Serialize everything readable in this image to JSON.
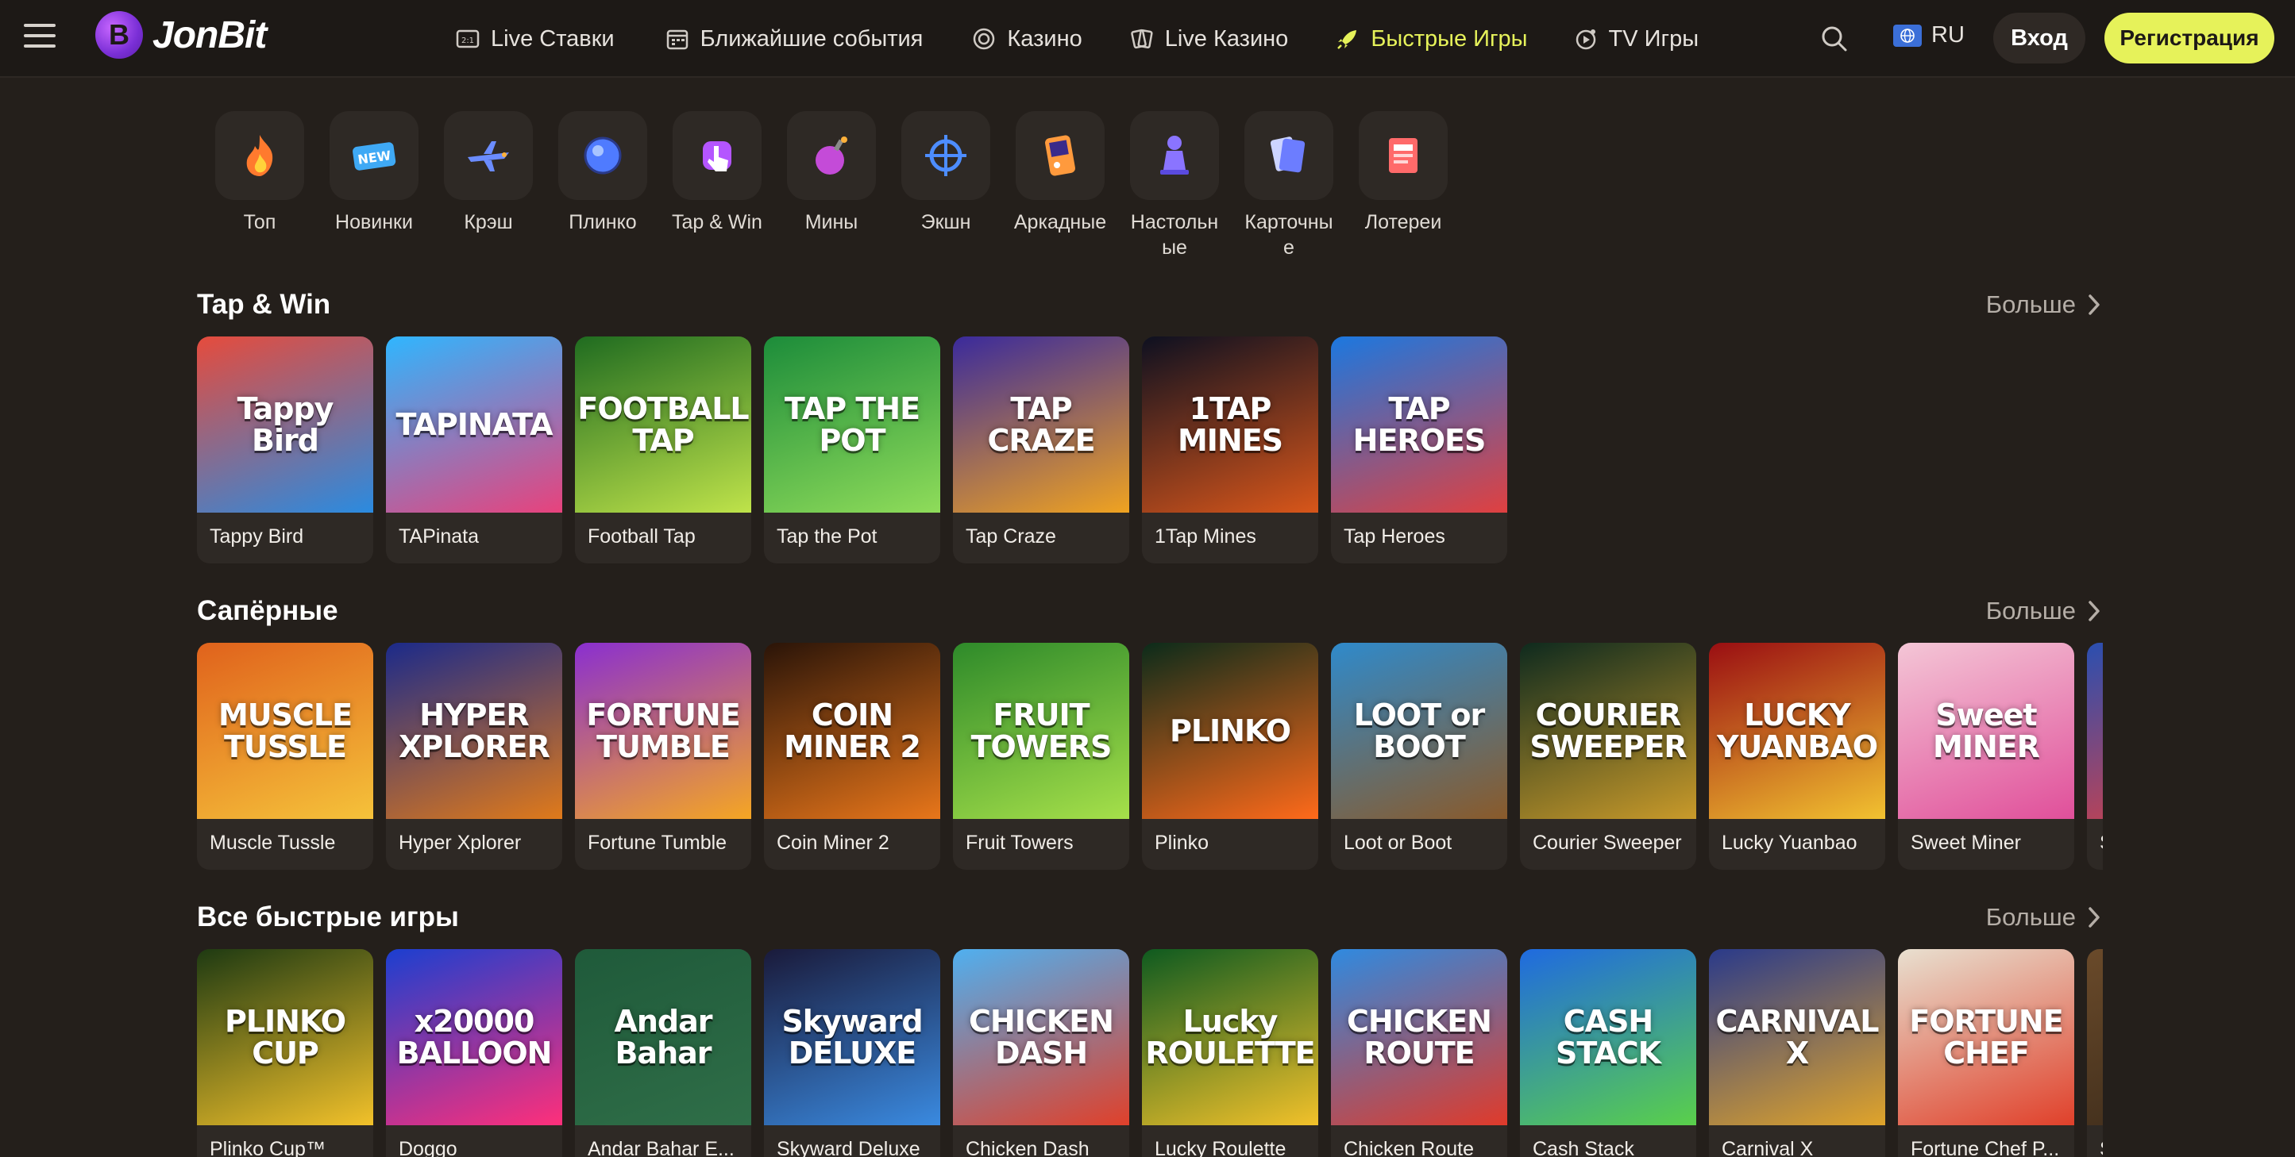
{
  "header": {
    "logo_text": "JonBit",
    "nav": [
      {
        "label": "Live Ставки",
        "icon": "live-bets-icon"
      },
      {
        "label": "Ближайшие события",
        "icon": "calendar-icon"
      },
      {
        "label": "Казино",
        "icon": "casino-chip-icon"
      },
      {
        "label": "Live Казино",
        "icon": "live-casino-cards-icon"
      },
      {
        "label": "Быстрые Игры",
        "icon": "rocket-icon",
        "active": true
      },
      {
        "label": "TV Игры",
        "icon": "tv-games-icon"
      }
    ],
    "language": "RU",
    "login_label": "Вход",
    "register_label": "Регистрация"
  },
  "categories": [
    {
      "label": "Топ",
      "icon": "flame-icon",
      "color": "#ff7a2e"
    },
    {
      "label": "Новинки",
      "icon": "new-badge-icon",
      "color": "#3fa9f5"
    },
    {
      "label": "Крэш",
      "icon": "plane-icon",
      "color": "#6b8cff"
    },
    {
      "label": "Плинко",
      "icon": "plinko-ball-icon",
      "color": "#4f7bff"
    },
    {
      "label": "Tap & Win",
      "icon": "tap-hand-icon",
      "color": "#b455ff"
    },
    {
      "label": "Мины",
      "icon": "mine-bomb-icon",
      "color": "#c44bd8"
    },
    {
      "label": "Экшн",
      "icon": "crosshair-icon",
      "color": "#4d8dff"
    },
    {
      "label": "Аркадные",
      "icon": "arcade-console-icon",
      "color": "#ff9a3d"
    },
    {
      "label": "Настольные",
      "icon": "board-game-icon",
      "color": "#8a74ff"
    },
    {
      "label": "Карточные",
      "icon": "playing-cards-icon",
      "color": "#6c7dff"
    },
    {
      "label": "Лотереи",
      "icon": "lottery-ticket-icon",
      "color": "#ff6a6a"
    }
  ],
  "more_label": "Больше",
  "sections": [
    {
      "title": "Tap & Win",
      "games": [
        {
          "name": "Tappy Bird",
          "art": "Tappy Bird",
          "bg": "#e64b3c",
          "bg2": "#2a8be0"
        },
        {
          "name": "TAPinata",
          "art": "TAPINATA",
          "bg": "#2fb6ff",
          "bg2": "#e8427c"
        },
        {
          "name": "Football Tap",
          "art": "FOOTBALL TAP",
          "bg": "#1f6b20",
          "bg2": "#bfe34a"
        },
        {
          "name": "Tap the Pot",
          "art": "TAP THE POT",
          "bg": "#1c8c3a",
          "bg2": "#8fdc5a"
        },
        {
          "name": "Tap Craze",
          "art": "TAP CRAZE",
          "bg": "#3a2a9c",
          "bg2": "#f0a320"
        },
        {
          "name": "1Tap Mines",
          "art": "1TAP MINES",
          "bg": "#0d1020",
          "bg2": "#d8561a"
        },
        {
          "name": "Tap Heroes",
          "art": "TAP HEROES",
          "bg": "#1b78e0",
          "bg2": "#e04040"
        }
      ]
    },
    {
      "title": "Сапёрные",
      "games": [
        {
          "name": "Muscle Tussle",
          "art": "MUSCLE TUSSLE",
          "bg": "#e0621c",
          "bg2": "#f5c23a"
        },
        {
          "name": "Hyper Xplorer",
          "art": "HYPER XPLORER",
          "bg": "#1b2a8a",
          "bg2": "#e07a1a"
        },
        {
          "name": "Fortune Tumble",
          "art": "FORTUNE TUMBLE",
          "bg": "#8a2fd0",
          "bg2": "#f5a623"
        },
        {
          "name": "Coin Miner 2",
          "art": "COIN MINER 2",
          "bg": "#2a1408",
          "bg2": "#e8761a"
        },
        {
          "name": "Fruit Towers",
          "art": "FRUIT TOWERS",
          "bg": "#2e8a2a",
          "bg2": "#a6e04a"
        },
        {
          "name": "Plinko",
          "art": "PLINKO",
          "bg": "#0b2b1a",
          "bg2": "#ff6a1a"
        },
        {
          "name": "Loot or Boot",
          "art": "LOOT or BOOT",
          "bg": "#2f8acb",
          "bg2": "#8a5a2a"
        },
        {
          "name": "Courier Sweeper",
          "art": "COURIER SWEEPER",
          "bg": "#0e2a1e",
          "bg2": "#c99a2a"
        },
        {
          "name": "Lucky Yuanbao",
          "art": "LUCKY YUANBAO",
          "bg": "#9a0e12",
          "bg2": "#f2c230"
        },
        {
          "name": "Sweet Miner",
          "art": "Sweet MINER",
          "bg": "#f4c6d6",
          "bg2": "#e04f9a"
        },
        {
          "name": "Snow",
          "art": "",
          "bg": "#2a4fb0",
          "bg2": "#e04040"
        }
      ]
    },
    {
      "title": "Все быстрые игры",
      "games": [
        {
          "name": "Plinko Cup™",
          "art": "PLINKO CUP",
          "bg": "#1e3a12",
          "bg2": "#f2c12a"
        },
        {
          "name": "Doggo",
          "art": "x20000 BALLOON",
          "bg": "#1b3fd0",
          "bg2": "#ff2f7a"
        },
        {
          "name": "Andar Bahar E...",
          "art": "Andar Bahar",
          "bg": "#1f5a3a",
          "bg2": "#2f6e48"
        },
        {
          "name": "Skyward Deluxe",
          "art": "Skyward DELUXE",
          "bg": "#1a1a3a",
          "bg2": "#3a8ae0"
        },
        {
          "name": "Chicken Dash",
          "art": "CHICKEN DASH",
          "bg": "#4fb0f0",
          "bg2": "#e0402a"
        },
        {
          "name": "Lucky Roulette",
          "art": "Lucky ROULETTE",
          "bg": "#0e5a20",
          "bg2": "#f2c12a"
        },
        {
          "name": "Chicken Route",
          "art": "CHICKEN ROUTE",
          "bg": "#2f8ae0",
          "bg2": "#e03a2a"
        },
        {
          "name": "Cash Stack",
          "art": "CASH STACK",
          "bg": "#1f6ae0",
          "bg2": "#5ad04a"
        },
        {
          "name": "Carnival X",
          "art": "CARNIVAL X",
          "bg": "#2a3a8a",
          "bg2": "#e0a42a"
        },
        {
          "name": "Fortune Chef P...",
          "art": "FORTUNE CHEF",
          "bg": "#e8e0d0",
          "bg2": "#e0402a"
        },
        {
          "name": "S",
          "art": "",
          "bg": "#6a4a2a",
          "bg2": "#3a2a1a"
        }
      ]
    }
  ]
}
